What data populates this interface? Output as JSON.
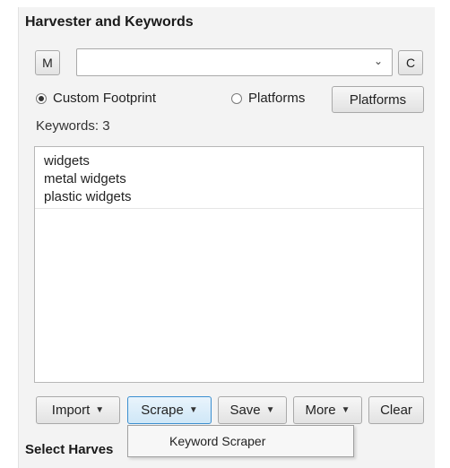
{
  "section_title": "Harvester and Keywords",
  "toolbar": {
    "m_button": "M",
    "c_button": "C",
    "dropdown_arrow": "⌄",
    "combo_value": ""
  },
  "radios": {
    "custom_footprint": "Custom Footprint",
    "platforms_radio": "Platforms",
    "platforms_button": "Platforms",
    "selected": "Custom Footprint"
  },
  "keywords": {
    "label": "Keywords:  3",
    "items": [
      "widgets",
      "metal widgets",
      "plastic widgets"
    ]
  },
  "buttons": {
    "import": "Import",
    "scrape": "Scrape",
    "save": "Save",
    "more": "More",
    "clear": "Clear",
    "caret": "▼"
  },
  "dropdown_menu": {
    "items": [
      "Keyword Scraper"
    ]
  },
  "bottom_section_title": "Select Harves"
}
